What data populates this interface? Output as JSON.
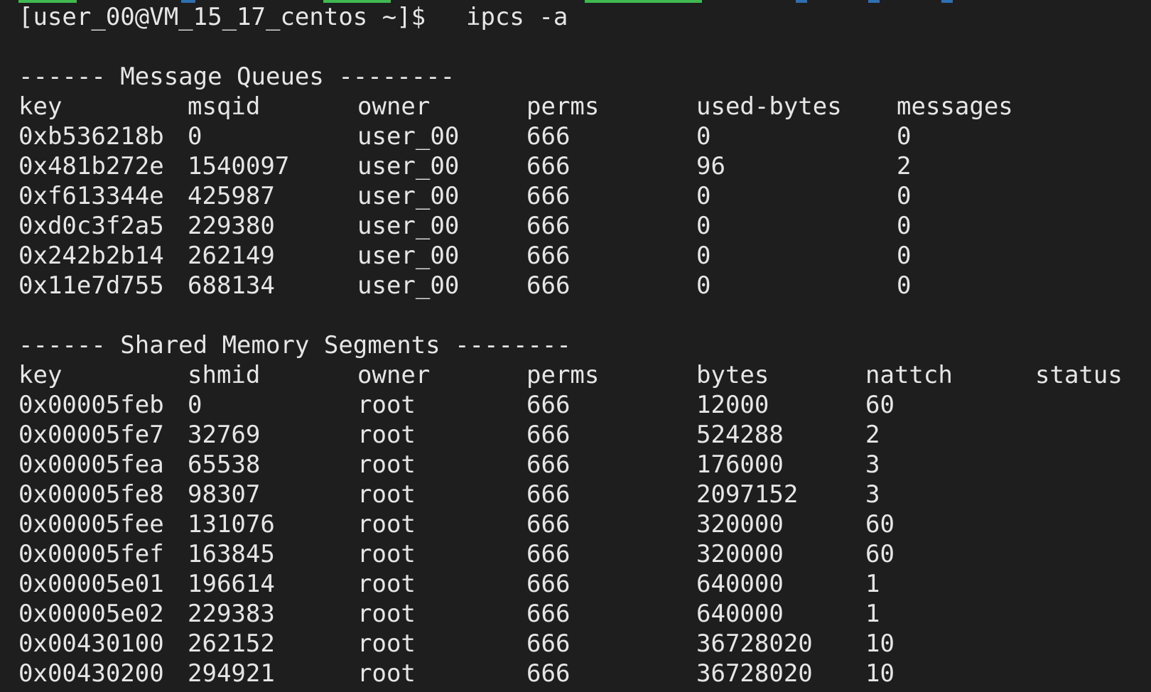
{
  "terminal": {
    "prompt": "[user_00@VM_15_17_centos ~]$",
    "command": "ipcs -a",
    "colors": {
      "background": "#1e1e1e",
      "foreground": "#e6e6e6",
      "strip_green": "#3fb950",
      "strip_blue": "#2f6fb3"
    }
  },
  "message_queues": {
    "title": "------ Message Queues --------",
    "columns": [
      "key",
      "msqid",
      "owner",
      "perms",
      "used-bytes",
      "messages"
    ],
    "rows": [
      [
        "0xb536218b",
        "0",
        "user_00",
        "666",
        "0",
        "0"
      ],
      [
        "0x481b272e",
        "1540097",
        "user_00",
        "666",
        "96",
        "2"
      ],
      [
        "0xf613344e",
        "425987",
        "user_00",
        "666",
        "0",
        "0"
      ],
      [
        "0xd0c3f2a5",
        "229380",
        "user_00",
        "666",
        "0",
        "0"
      ],
      [
        "0x242b2b14",
        "262149",
        "user_00",
        "666",
        "0",
        "0"
      ],
      [
        "0x11e7d755",
        "688134",
        "user_00",
        "666",
        "0",
        "0"
      ]
    ]
  },
  "shared_memory": {
    "title": "------ Shared Memory Segments --------",
    "columns": [
      "key",
      "shmid",
      "owner",
      "perms",
      "bytes",
      "nattch",
      "status"
    ],
    "rows": [
      [
        "0x00005feb",
        "0",
        "root",
        "666",
        "12000",
        "60",
        ""
      ],
      [
        "0x00005fe7",
        "32769",
        "root",
        "666",
        "524288",
        "2",
        ""
      ],
      [
        "0x00005fea",
        "65538",
        "root",
        "666",
        "176000",
        "3",
        ""
      ],
      [
        "0x00005fe8",
        "98307",
        "root",
        "666",
        "2097152",
        "3",
        ""
      ],
      [
        "0x00005fee",
        "131076",
        "root",
        "666",
        "320000",
        "60",
        ""
      ],
      [
        "0x00005fef",
        "163845",
        "root",
        "666",
        "320000",
        "60",
        ""
      ],
      [
        "0x00005e01",
        "196614",
        "root",
        "666",
        "640000",
        "1",
        ""
      ],
      [
        "0x00005e02",
        "229383",
        "root",
        "666",
        "640000",
        "1",
        ""
      ],
      [
        "0x00430100",
        "262152",
        "root",
        "666",
        "36728020",
        "10",
        ""
      ],
      [
        "0x00430200",
        "294921",
        "root",
        "666",
        "36728020",
        "10",
        ""
      ]
    ]
  }
}
